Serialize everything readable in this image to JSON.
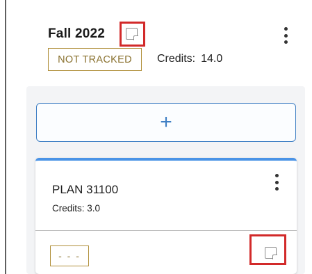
{
  "term": {
    "title": "Fall 2022",
    "status": "NOT TRACKED",
    "credits_label": "Credits:",
    "credits_value": "14.0",
    "note_icon": "note-icon",
    "menu_icon": "more-vertical-icon"
  },
  "add_course": {
    "label": "+"
  },
  "course": {
    "code": "PLAN 31100",
    "credits_text": "Credits: 3.0",
    "grade": "- - -",
    "note_icon": "note-icon",
    "menu_icon": "more-vertical-icon"
  },
  "colors": {
    "highlight": "#d22a2a",
    "accent_blue": "#3f7fc4",
    "card_top_border": "#4a93e6",
    "badge_gold": "#b08f3a"
  }
}
